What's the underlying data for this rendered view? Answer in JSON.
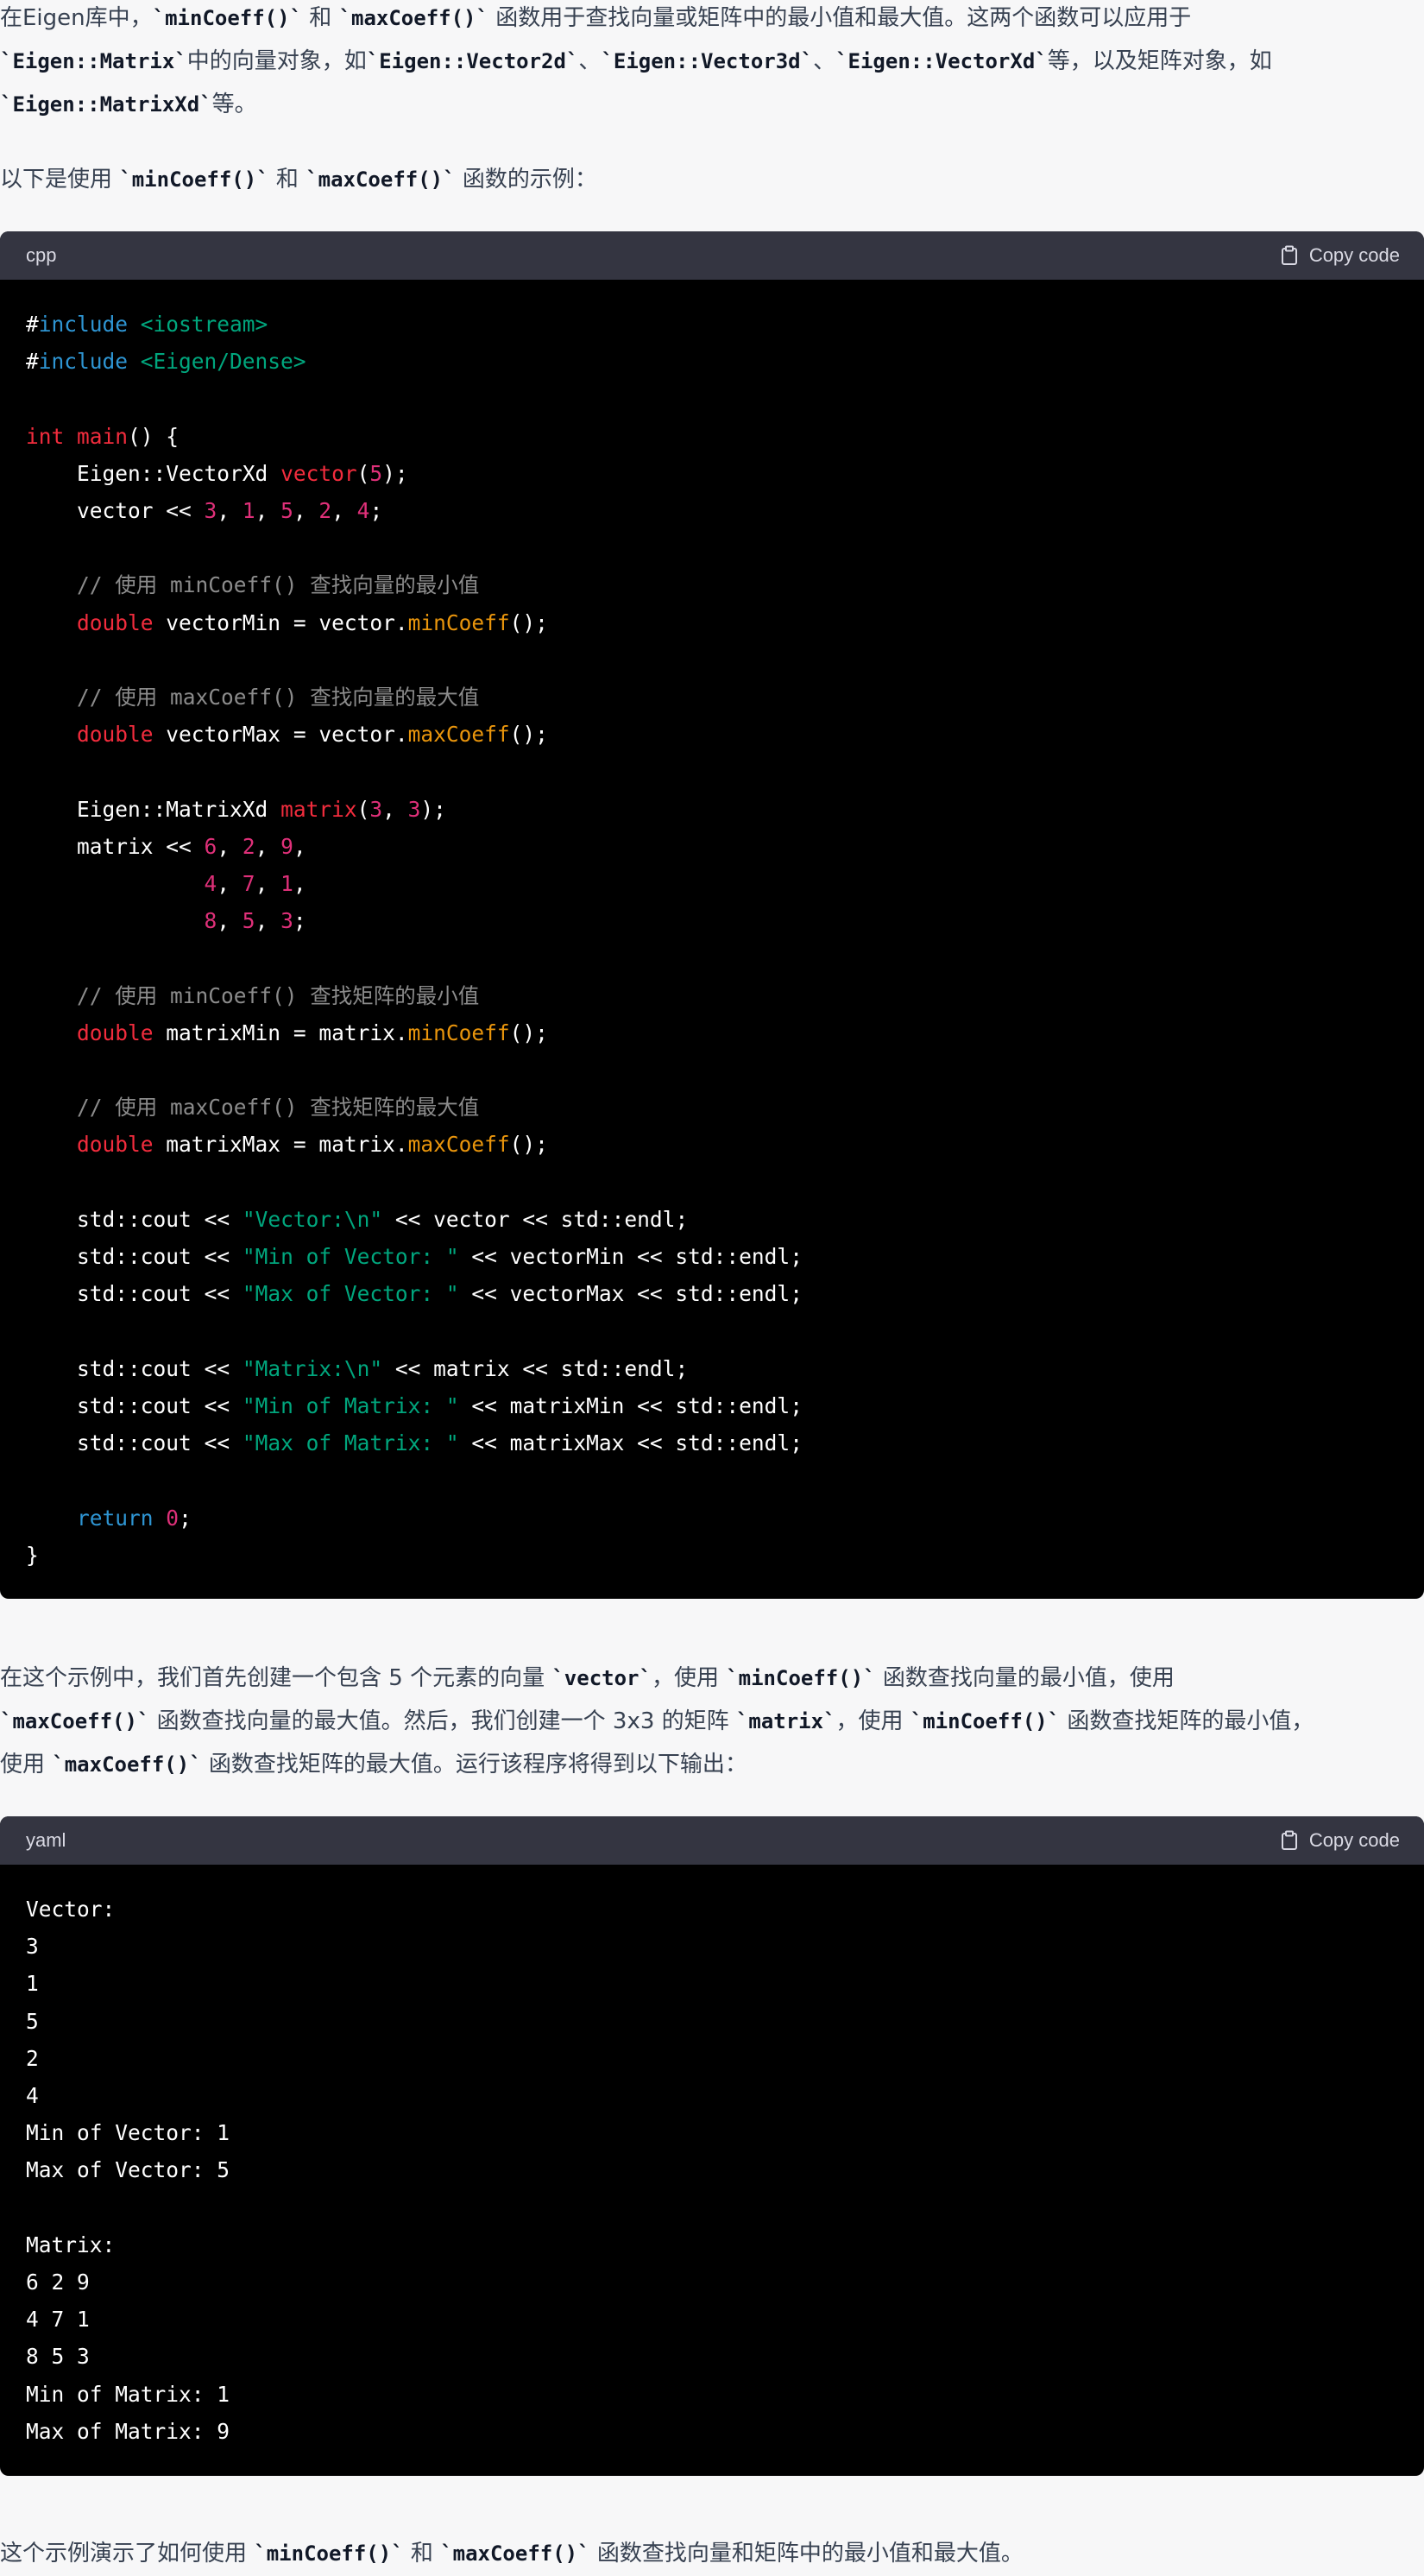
{
  "intro": {
    "line1_a": "在Eigen库中，",
    "line1_code1": "`minCoeff()`",
    "line1_b": " 和 ",
    "line1_code2": "`maxCoeff()`",
    "line1_c": " 函数用于查找向量或矩阵中的最小值和最大值。这两个函数可以应用于",
    "line2_code1": "`Eigen::Matrix`",
    "line2_a": "中的向量对象，如",
    "line2_code2": "`Eigen::Vector2d`",
    "line2_b": "、",
    "line2_code3": "`Eigen::Vector3d`",
    "line2_c": "、",
    "line2_code4": "`Eigen::VectorXd`",
    "line2_d": "等，以及矩阵对象，如",
    "line3_code1": "`Eigen::MatrixXd`",
    "line3_a": "等。"
  },
  "lead": {
    "a": "以下是使用 ",
    "code1": "`minCoeff()`",
    "b": " 和 ",
    "code2": "`maxCoeff()`",
    "c": " 函数的示例："
  },
  "code_block_1": {
    "language": "cpp",
    "copy_label": "Copy code",
    "lines": [
      "#include <iostream>",
      "#include <Eigen/Dense>",
      "",
      "int main() {",
      "    Eigen::VectorXd vector(5);",
      "    vector << 3, 1, 5, 2, 4;",
      "",
      "    // 使用 minCoeff() 查找向量的最小值",
      "    double vectorMin = vector.minCoeff();",
      "",
      "    // 使用 maxCoeff() 查找向量的最大值",
      "    double vectorMax = vector.maxCoeff();",
      "",
      "    Eigen::MatrixXd matrix(3, 3);",
      "    matrix << 6, 2, 9,",
      "              4, 7, 1,",
      "              8, 5, 3;",
      "",
      "    // 使用 minCoeff() 查找矩阵的最小值",
      "    double matrixMin = matrix.minCoeff();",
      "",
      "    // 使用 maxCoeff() 查找矩阵的最大值",
      "    double matrixMax = matrix.maxCoeff();",
      "",
      "    std::cout << \"Vector:\\n\" << vector << std::endl;",
      "    std::cout << \"Min of Vector: \" << vectorMin << std::endl;",
      "    std::cout << \"Max of Vector: \" << vectorMax << std::endl;",
      "",
      "    std::cout << \"Matrix:\\n\" << matrix << std::endl;",
      "    std::cout << \"Min of Matrix: \" << matrixMin << std::endl;",
      "    std::cout << \"Max of Matrix: \" << matrixMax << std::endl;",
      "",
      "    return 0;",
      "}"
    ]
  },
  "explain": {
    "l1_a": "在这个示例中，我们首先创建一个包含 5 个元素的向量 ",
    "l1_code1": "`vector`",
    "l1_b": "，使用 ",
    "l1_code2": "`minCoeff()`",
    "l1_c": " 函数查找向量的最小值，使用",
    "l2_code1": "`maxCoeff()`",
    "l2_a": " 函数查找向量的最大值。然后，我们创建一个 3x3 的矩阵 ",
    "l2_code2": "`matrix`",
    "l2_b": "，使用 ",
    "l2_code3": "`minCoeff()`",
    "l2_c": " 函数查找矩阵的最小值，",
    "l3_a": "使用 ",
    "l3_code1": "`maxCoeff()`",
    "l3_b": " 函数查找矩阵的最大值。运行该程序将得到以下输出："
  },
  "code_block_2": {
    "language": "yaml",
    "copy_label": "Copy code",
    "lines": [
      "Vector:",
      "3",
      "1",
      "5",
      "2",
      "4",
      "Min of Vector: 1",
      "Max of Vector: 5",
      "",
      "Matrix:",
      "6 2 9",
      "4 7 1",
      "8 5 3",
      "Min of Matrix: 1",
      "Max of Matrix: 9"
    ]
  },
  "closing": {
    "a": "这个示例演示了如何使用 ",
    "code1": "`minCoeff()`",
    "b": " 和 ",
    "code2": "`maxCoeff()`",
    "c": " 函数查找向量和矩阵中的最小值和最大值。"
  },
  "colors": {
    "code_bg": "#000000",
    "code_header_bg": "#343541",
    "keyword": "#2e95d3",
    "string": "#00a67d",
    "number": "#df3079",
    "method": "#e9950c",
    "comment": "#8b8b8b"
  },
  "icons": {
    "copy": "clipboard-icon"
  }
}
